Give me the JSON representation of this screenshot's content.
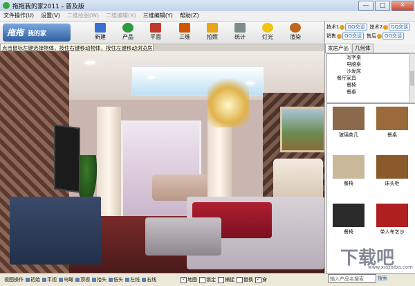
{
  "window": {
    "title": "拖拖我的家2011 - 普及版",
    "min": "—",
    "max": "□",
    "close": "✕"
  },
  "menu": [
    {
      "label": "文件操作(U)",
      "disabled": false
    },
    {
      "label": "设置(V)",
      "disabled": false
    },
    {
      "label": "二维绘图(W)",
      "disabled": true
    },
    {
      "label": "二维编辑(X)",
      "disabled": true
    },
    {
      "label": "三维编辑(Y)",
      "disabled": false
    },
    {
      "label": "帮助(Z)",
      "disabled": false
    }
  ],
  "logo": {
    "text": "拖拖",
    "sub": "我的家"
  },
  "toolbar": [
    {
      "name": "new",
      "label": "新建",
      "color": "#3b6fd0"
    },
    {
      "name": "product",
      "label": "产品",
      "color": "#2e9b3e"
    },
    {
      "name": "plan",
      "label": "平面",
      "color": "#c0392b"
    },
    {
      "name": "3d",
      "label": "三维",
      "color": "#d35400"
    },
    {
      "name": "photo",
      "label": "拍照",
      "color": "#e8a317"
    },
    {
      "name": "stats",
      "label": "统计",
      "color": "#7f8c8d"
    },
    {
      "name": "light",
      "label": "灯光",
      "color": "#f1c40f"
    },
    {
      "name": "render",
      "label": "渲染",
      "color": "#c0661a"
    }
  ],
  "support": {
    "row1": [
      "技术1",
      "QQ交谈",
      "技术2",
      "QQ交谈"
    ],
    "row2": [
      "销售",
      "QQ交谈",
      "售后",
      "QQ交谈"
    ]
  },
  "hint": "点击鼠标左键选择物体，按住右键移动物体，按住左键移动浏览房间",
  "panel": {
    "tabs": [
      "家居产品",
      "几何体"
    ],
    "tree": [
      "写字桌",
      "电脑桌",
      "沙发床",
      "餐厅家具",
      "餐椅",
      "餐桌"
    ],
    "products": [
      {
        "label": "玻璃茶几",
        "color": "#8a6a4a"
      },
      {
        "label": "餐桌",
        "color": "#9a6a3a"
      },
      {
        "label": "餐椅",
        "color": "#c9b89a"
      },
      {
        "label": "床头柜",
        "color": "#8a5a2a"
      },
      {
        "label": "餐椅",
        "color": "#2a2a2a"
      },
      {
        "label": "单人布艺沙",
        "color": "#b02020"
      }
    ]
  },
  "bottombar": {
    "items": [
      "视图操作",
      "初始",
      "平视",
      "鸟瞰",
      "顶视",
      "抬头",
      "低头",
      "左线",
      "右线"
    ],
    "checks": [
      {
        "label": "地图",
        "checked": true
      },
      {
        "label": "锁定",
        "checked": false
      },
      {
        "label": "捕捉",
        "checked": false
      },
      {
        "label": "替换",
        "checked": false
      },
      {
        "label": "穿",
        "checked": true
      }
    ],
    "search_placeholder": "输入产品名搜索",
    "search_button": "搜索"
  },
  "watermark": {
    "text": "下载吧",
    "url": "www.xiazaiba.com"
  }
}
